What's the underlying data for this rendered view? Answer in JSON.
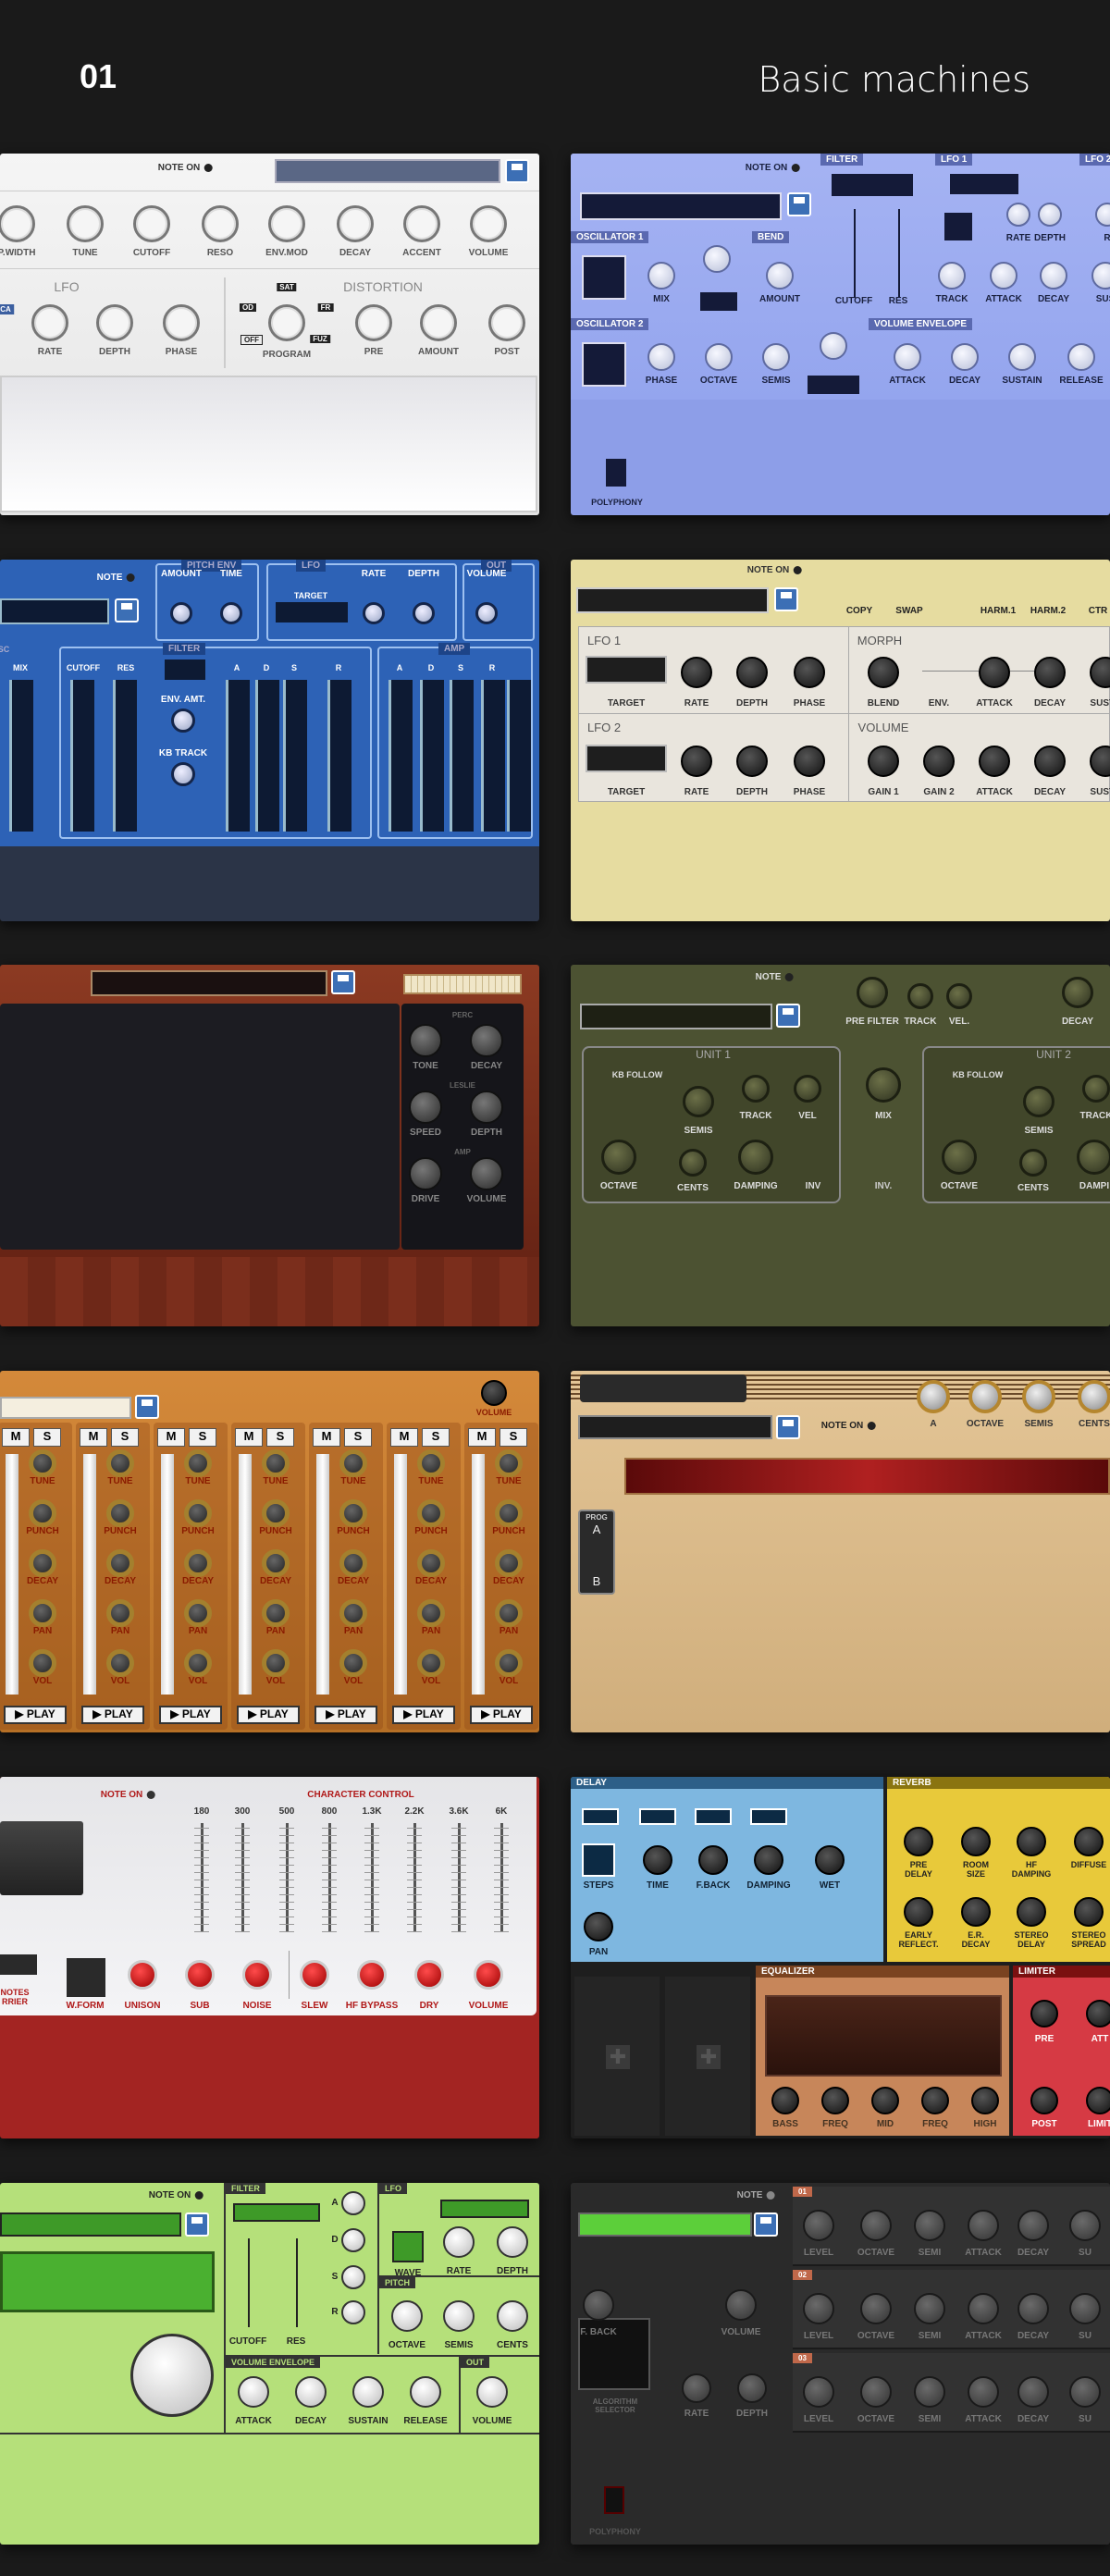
{
  "header": {
    "number": "01",
    "title": "Basic machines"
  },
  "p1": {
    "note_on": "NOTE ON",
    "knobs": [
      "P.WIDTH",
      "TUNE",
      "CUTOFF",
      "RESO",
      "ENV.MOD",
      "DECAY",
      "ACCENT",
      "VOLUME"
    ],
    "lfo_title": "LFO",
    "lfo_knobs": [
      "RATE",
      "DEPTH",
      "PHASE"
    ],
    "dist_title": "DISTORTION",
    "dist_knobs": [
      "PRE",
      "AMOUNT",
      "POST"
    ],
    "program": "PROGRAM",
    "prog_marks": [
      "SAT",
      "OD",
      "FR",
      "OFF",
      "FUZ"
    ],
    "ca": "CA"
  },
  "p2": {
    "note_on": "NOTE ON",
    "sections": [
      "FILTER",
      "LFO 1",
      "LFO 2",
      "OSCILLATOR 1",
      "BEND",
      "OSCILLATOR 2",
      "VOLUME ENVELOPE"
    ],
    "lfo_knobs": [
      "RATE",
      "DEPTH",
      "R"
    ],
    "osc1": [
      "MIX",
      "AMOUNT"
    ],
    "filter": [
      "CUTOFF",
      "RES"
    ],
    "env1": [
      "TRACK",
      "ATTACK",
      "DECAY",
      "SUS"
    ],
    "osc2": [
      "PHASE",
      "OCTAVE",
      "SEMIS"
    ],
    "venv": [
      "ATTACK",
      "DECAY",
      "SUSTAIN",
      "RELEASE"
    ],
    "poly": "POLYPHONY"
  },
  "p3": {
    "note": "NOTE",
    "sections": [
      "PITCH ENV",
      "LFO",
      "OUT",
      "FILTER",
      "AMP"
    ],
    "pitch": [
      "AMOUNT",
      "TIME"
    ],
    "lfo": [
      "TARGET",
      "RATE",
      "DEPTH"
    ],
    "out": [
      "VOLUME"
    ],
    "osc": [
      "SC",
      "MIX"
    ],
    "filter": [
      "CUTOFF",
      "RES",
      "ENV. AMT.",
      "KB TRACK"
    ],
    "adsr": [
      "A",
      "D",
      "S",
      "R"
    ]
  },
  "p4": {
    "note_on": "NOTE ON",
    "top": [
      "COPY",
      "SWAP",
      "HARM.1",
      "HARM.2",
      "CTR"
    ],
    "lfo1": "LFO 1",
    "lfo2": "LFO 2",
    "morph": "MORPH",
    "volume": "VOLUME",
    "lfo_knobs": [
      "TARGET",
      "RATE",
      "DEPTH",
      "PHASE"
    ],
    "morph_knobs": [
      "BLEND",
      "ENV.",
      "ATTACK",
      "DECAY",
      "SUSTA"
    ],
    "vol_knobs": [
      "GAIN 1",
      "GAIN 2",
      "ATTACK",
      "DECAY",
      "SUSTA"
    ]
  },
  "p5": {
    "display": "",
    "perc": "PERC",
    "leslie": "LESLIE",
    "amp": "AMP",
    "knobs": [
      "TONE",
      "DECAY",
      "SPEED",
      "DEPTH",
      "DRIVE",
      "VOLUME"
    ]
  },
  "p6": {
    "note": "NOTE",
    "top": [
      "PRE FILTER",
      "TRACK",
      "VEL.",
      "DECAY"
    ],
    "unit1": "UNIT 1",
    "unit2": "UNIT 2",
    "kb": "KB FOLLOW",
    "u_knobs": [
      "SEMIS",
      "TRACK",
      "VEL",
      "OCTAVE",
      "CENTS",
      "DAMPING",
      "INV"
    ],
    "mix": "MIX",
    "inv": "INV.",
    "u2_knobs": [
      "SEMIS",
      "TRACK",
      "OCTAVE",
      "CENTS",
      "DAMPI"
    ]
  },
  "p7": {
    "volume": "VOLUME",
    "ms": [
      "M",
      "S"
    ],
    "knobs": [
      "TUNE",
      "PUNCH",
      "DECAY",
      "PAN",
      "VOL"
    ],
    "play": "▶ PLAY"
  },
  "p8": {
    "note_on": "NOTE ON",
    "knobs": [
      "A",
      "OCTAVE",
      "SEMIS",
      "CENTS"
    ],
    "prog": "PROG",
    "ab": [
      "A",
      "B"
    ]
  },
  "p9": {
    "note_on": "NOTE ON",
    "title": "CHARACTER CONTROL",
    "freqs": [
      "180",
      "300",
      "500",
      "800",
      "1.3K",
      "2.2K",
      "3.6K",
      "6K"
    ],
    "knobs": [
      "W.FORM",
      "UNISON",
      "SUB",
      "NOISE",
      "SLEW",
      "HF BYPASS",
      "DRY",
      "VOLUME"
    ],
    "left": [
      "NOTES",
      "RRIER"
    ]
  },
  "p10": {
    "delay": "DELAY",
    "reverb": "REVERB",
    "equalizer": "EQUALIZER",
    "limiter": "LIMITER",
    "delay_knobs": [
      "STEPS",
      "TIME",
      "F.BACK",
      "DAMPING",
      "WET",
      "PAN"
    ],
    "rev_knobs": [
      "PRE\nDELAY",
      "ROOM\nSIZE",
      "HF\nDAMPING",
      "DIFFUSE",
      "EARLY\nREFLECT.",
      "E.R.\nDECAY",
      "STEREO\nDELAY",
      "STEREO\nSPREAD"
    ],
    "eq_knobs": [
      "BASS",
      "FREQ",
      "MID",
      "FREQ",
      "HIGH"
    ],
    "lim_knobs": [
      "PRE",
      "ATT",
      "POST",
      "LIMIT"
    ]
  },
  "p11": {
    "note_on": "NOTE ON",
    "sections": [
      "FILTER",
      "LFO",
      "PITCH",
      "VOLUME ENVELOPE",
      "OUT"
    ],
    "adsr": [
      "A",
      "D",
      "S",
      "R"
    ],
    "filter": [
      "CUTOFF",
      "RES"
    ],
    "lfo": [
      "WAVE",
      "RATE",
      "DEPTH"
    ],
    "pitch": [
      "OCTAVE",
      "SEMIS",
      "CENTS"
    ],
    "venv": [
      "ATTACK",
      "DECAY",
      "SUSTAIN",
      "RELEASE"
    ],
    "out": [
      "VOLUME"
    ]
  },
  "p12": {
    "note": "NOTE",
    "ops": [
      "01",
      "02",
      "03"
    ],
    "op_knobs": [
      "LEVEL",
      "OCTAVE",
      "SEMI",
      "ATTACK",
      "DECAY",
      "SU"
    ],
    "fb": [
      "F. BACK",
      "VOLUME"
    ],
    "algo": "ALGORITHM\nSELECTOR",
    "rd": [
      "RATE",
      "DEPTH"
    ],
    "poly": "POLYPHONY"
  },
  "colors": {
    "bg": "#1a1a1a",
    "white": "#f2f2f2",
    "periwinkle": "#8d9ee8",
    "blue": "#2f63b6",
    "cream": "#e6dca0",
    "wood": "#7b2c1e",
    "olive": "#4c5232",
    "orange": "#c8822e",
    "tan": "#d9b98c",
    "red": "#a32422",
    "lime": "#b5e07a",
    "dark": "#2a2a2a"
  }
}
